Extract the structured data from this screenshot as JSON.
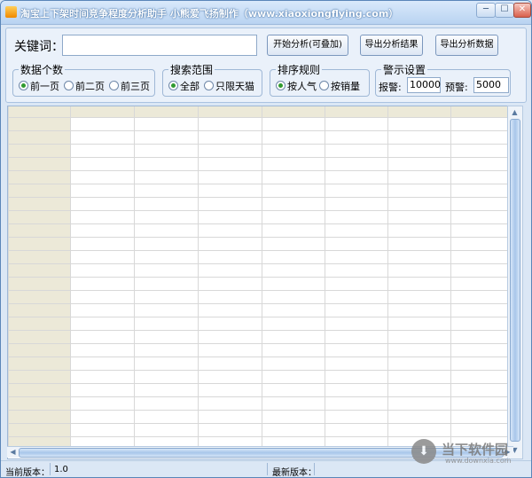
{
  "window": {
    "title": "淘宝上下架时间竞争程度分析助手      小熊爱飞扬制作（www.xiaoxiongflying.com）",
    "min_glyph": "─",
    "max_glyph": "☐",
    "close_glyph": "✕"
  },
  "search": {
    "keyword_label": "关键词：",
    "keyword_value": ""
  },
  "buttons": {
    "start_analysis": "开始分析(可叠加)",
    "export_results": "导出分析结果",
    "export_data": "导出分析数据"
  },
  "groups": {
    "data_count": {
      "title": "数据个数",
      "options": [
        "前一页",
        "前二页",
        "前三页"
      ],
      "selected": 0
    },
    "search_scope": {
      "title": "搜索范围",
      "options": [
        "全部",
        "只限天猫"
      ],
      "selected": 0
    },
    "sort_rule": {
      "title": "排序规则",
      "options": [
        "按人气",
        "按销量"
      ],
      "selected": 0
    },
    "alert_settings": {
      "title": "警示设置",
      "alarm_label": "报警:",
      "alarm_value": "10000",
      "warning_label": "预警:",
      "warning_value": "5000"
    }
  },
  "statusbar": {
    "current_version_label": "当前版本：",
    "current_version": "1.0",
    "latest_version_label": "最新版本："
  },
  "watermark": {
    "brand": "当下软件园",
    "url": "www.downxia.com"
  },
  "colors": {
    "header_fill": "#ece9d8",
    "grid_line": "#d8d8d8",
    "accent_radio": "#2f9a2f"
  }
}
